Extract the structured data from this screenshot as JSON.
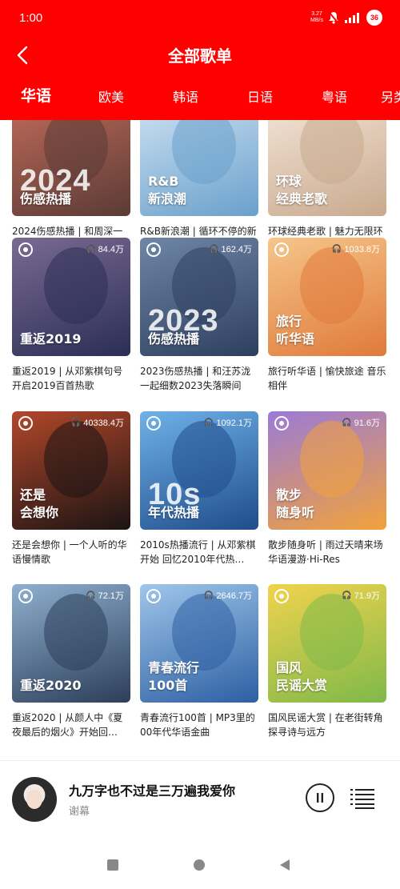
{
  "status_bar": {
    "time": "1:00",
    "net_speed": "3.27",
    "net_unit": "MB/s",
    "battery": "36"
  },
  "header": {
    "title": "全部歌单"
  },
  "tabs": [
    "华语",
    "欧美",
    "韩语",
    "日语",
    "粤语",
    "另类"
  ],
  "playlists": [
    {
      "cover_year": "2024",
      "cover_title": [
        "伤感热播"
      ],
      "plays": "",
      "desc": "2024伤感热播 | 和周深一起回望2024的那些遗憾",
      "colors": [
        "#5a3b36",
        "#c26b5a"
      ]
    },
    {
      "cover_year": "",
      "cover_title": [
        "R&B",
        "新浪潮"
      ],
      "plays": "",
      "desc": "R&B新浪潮 | 循环不停的新潮华语R&B",
      "colors": [
        "#6aa0cc",
        "#cfe3f2"
      ]
    },
    {
      "cover_year": "",
      "cover_title": [
        "环球",
        "经典老歌"
      ],
      "plays": "",
      "desc": "环球经典老歌 | 魅力无限环球音乐精选",
      "colors": [
        "#c9a98e",
        "#f4e6d8"
      ]
    },
    {
      "cover_year": "",
      "cover_title": [
        "重返2019"
      ],
      "plays": "84.4万",
      "desc": "重返2019 | 从邓紫棋句号开启2019百首热歌",
      "colors": [
        "#2b2e55",
        "#7a6a92"
      ]
    },
    {
      "cover_year": "2023",
      "cover_title": [
        "伤感热播"
      ],
      "plays": "162.4万",
      "desc": "2023伤感热播 | 和汪苏泷一起细数2023失落瞬间",
      "colors": [
        "#2e3f5e",
        "#6f86a6"
      ]
    },
    {
      "cover_year": "",
      "cover_title": [
        "旅行",
        "听华语"
      ],
      "plays": "1033.8万",
      "desc": "旅行听华语 | 愉快旅途 音乐相伴",
      "colors": [
        "#e07a3a",
        "#f6c58a"
      ]
    },
    {
      "cover_year": "",
      "cover_title": [
        "还是",
        "会想你"
      ],
      "plays": "40338.4万",
      "desc": "还是会想你 | 一个人听的华语慢情歌",
      "colors": [
        "#1b1414",
        "#b2472a"
      ]
    },
    {
      "cover_year": "10s",
      "cover_title": [
        "年代热播"
      ],
      "plays": "1092.1万",
      "desc": "2010s热播流行 | 从邓紫棋开始 回忆2010年代热…",
      "colors": [
        "#1f4c8c",
        "#6fb2e8"
      ]
    },
    {
      "cover_year": "",
      "cover_title": [
        "散步",
        "随身听"
      ],
      "plays": "91.6万",
      "desc": "散步随身听 | 雨过天晴来场华语漫游·Hi-Res",
      "colors": [
        "#f2a23a",
        "#9b7ad8"
      ]
    },
    {
      "cover_year": "",
      "cover_title": [
        "重返2020"
      ],
      "plays": "72.1万",
      "desc": "重返2020 | 从颜人中《夏夜最后的烟火》开始回…",
      "colors": [
        "#2c3e5a",
        "#8fb0cf"
      ]
    },
    {
      "cover_year": "",
      "cover_title": [
        "青春流行",
        "100首"
      ],
      "plays": "2646.7万",
      "desc": "青春流行100首 | MP3里的00年代华语金曲",
      "colors": [
        "#2d5fa3",
        "#9fc6ea"
      ]
    },
    {
      "cover_year": "",
      "cover_title": [
        "国风",
        "民谣大赏"
      ],
      "plays": "71.9万",
      "desc": "国风民谣大赏 | 在老街转角探寻诗与远方",
      "colors": [
        "#7fb94a",
        "#f1d34c"
      ]
    }
  ],
  "now_playing": {
    "song": "九万字也不过是三万遍我爱你",
    "artist": "谢幕"
  },
  "colors": {
    "brand_red": "#ff0000"
  }
}
